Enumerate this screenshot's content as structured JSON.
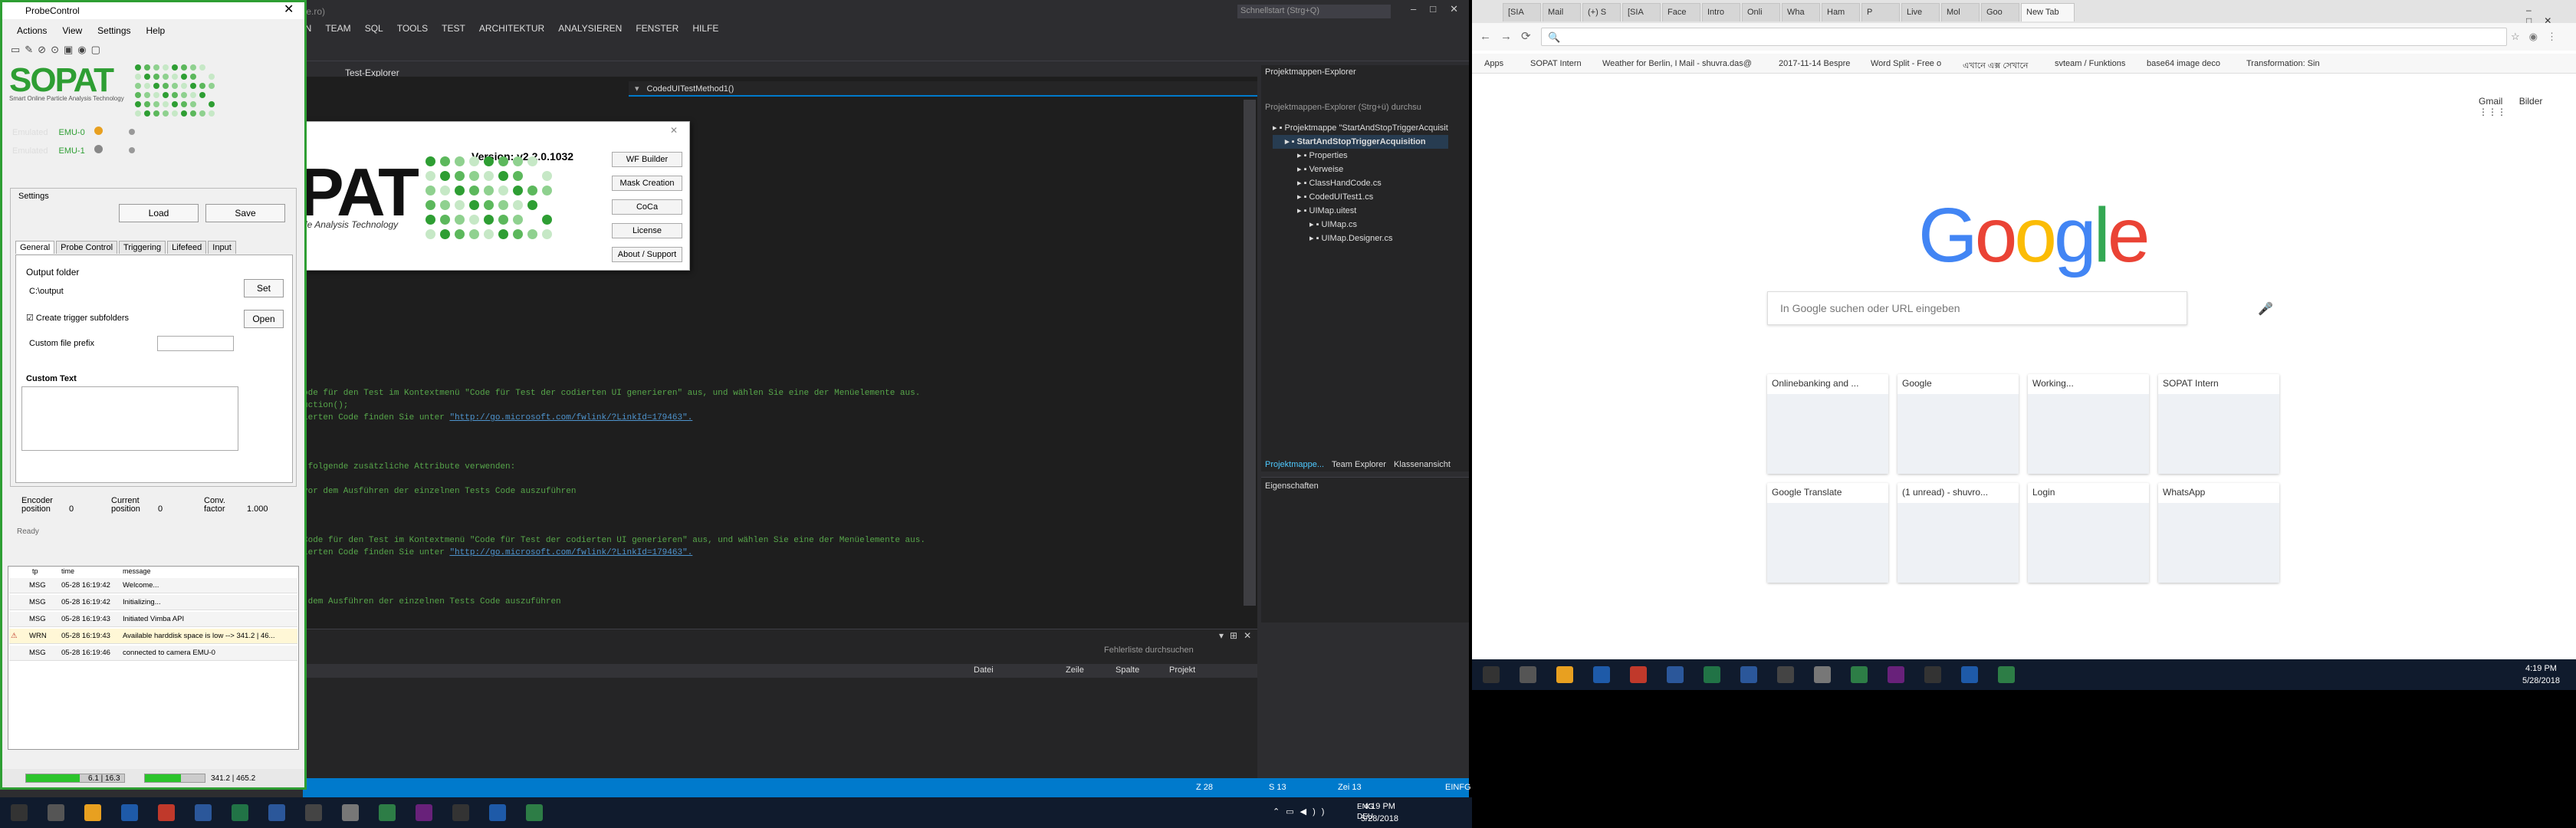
{
  "vs": {
    "title_fragment": "ine.ro)",
    "quick_launch": "Schnellstart (Strg+Q)",
    "menu": [
      "IGN",
      "TEAM",
      "SQL",
      "TOOLS",
      "TEST",
      "ARCHITEKTUR",
      "ANALYSIEREN",
      "FENSTER",
      "HILFE"
    ],
    "tab_test_explorer": "Test-Explorer",
    "doc_tab": "CodedUITestMethod1()",
    "code_lines": [
      {
        "text": "ode für den Test im Kontextmenü \"Code für Test der codierten UI generieren\" aus, und wählen Sie eine der Menüelemente aus.",
        "link": ""
      },
      {
        "text": "uction();",
        "link": ""
      },
      {
        "text": "ierten Code finden Sie unter ",
        "link": "\"http://go.microsoft.com/fwlink/?LinkId=179463\"."
      },
      {
        "text": "",
        "link": ""
      },
      {
        "text": "",
        "link": ""
      },
      {
        "text": "",
        "link": ""
      },
      {
        "text": " folgende zusätzliche Attribute verwenden:",
        "link": ""
      },
      {
        "text": "",
        "link": ""
      },
      {
        "text": "vor dem Ausführen der einzelnen Tests Code auszuführen",
        "link": ""
      },
      {
        "text": "",
        "link": ""
      },
      {
        "text": "",
        "link": ""
      },
      {
        "text": "",
        "link": ""
      },
      {
        "text": "Code für den Test im Kontextmenü \"Code für Test der codierten UI generieren\" aus, und wählen Sie eine der Menüelemente aus.",
        "link": ""
      },
      {
        "text": "ierten Code finden Sie unter ",
        "link": "\"http://go.microsoft.com/fwlink/?LinkId=179463\"."
      },
      {
        "text": "",
        "link": ""
      },
      {
        "text": "",
        "link": ""
      },
      {
        "text": "",
        "link": ""
      },
      {
        "text": " dem Ausführen der einzelnen Tests Code auszuführen",
        "link": ""
      }
    ],
    "errlist": {
      "search": "Fehlerliste durchsuchen",
      "cols": [
        "Datei",
        "Zeile",
        "Spalte",
        "Projekt"
      ]
    },
    "status": {
      "col": "Z 28",
      "sp": "S 13",
      "zei": "Zei 13",
      "mode": "EINFG"
    },
    "solution": {
      "header": "Projektmappen-Explorer",
      "search": "Projektmappen-Explorer (Strg+ü) durchsu",
      "items": [
        "Projektmappe \"StartAndStopTriggerAcquisit",
        "StartAndStopTriggerAcquisition",
        "Properties",
        "Verweise",
        "ClassHandCode.cs",
        "CodedUITest1.cs",
        "UIMap.uitest",
        "UIMap.cs",
        "UIMap.Designer.cs"
      ],
      "tabs": [
        "Projektmappe...",
        "Team Explorer",
        "Klassenansicht"
      ],
      "properties": "Eigenschaften"
    }
  },
  "chrome": {
    "tabs": [
      "[SIA",
      "Mail",
      "(+) S",
      "[SIA",
      "Face",
      "Intro",
      "Onli",
      "Wha",
      "Ham",
      "P",
      "Live",
      "Mol",
      "Goo",
      "New Tab"
    ],
    "bookmarks": [
      "Apps",
      "SOPAT Intern",
      "Weather for Berlin, I",
      "Mail - shuvra.das@",
      "2017-11-14 Bespre",
      "Word Split - Free o",
      "এখানে এক্স সেখানে",
      "svteam / Funktions",
      "base64 image deco",
      "Transformation: Sin"
    ],
    "top_links": [
      "Gmail",
      "Bilder"
    ],
    "search_placeholder": "In Google suchen oder URL eingeben",
    "tiles": [
      "Onlinebanking and ...",
      "Google",
      "Working...",
      "SOPAT Intern",
      "Google Translate",
      "(1 unread) - shuvro...",
      "Login",
      "WhatsApp"
    ],
    "clock_time": "4:19 PM",
    "clock_date": "5/28/2018"
  },
  "taskbar_left": {
    "lang": "ENG",
    "locale": "DEU",
    "time": "4:19 PM",
    "date": "5/28/2018"
  },
  "probe": {
    "title": "ProbeControl",
    "menu": [
      "Actions",
      "View",
      "Settings",
      "Help"
    ],
    "logo": "SOPAT",
    "logo_tagline": "Smart Online Particle Analysis Technology",
    "emulated": [
      {
        "label": "Emulated",
        "name": "EMU-0",
        "color": "#e8a020"
      },
      {
        "label": "Emulated",
        "name": "EMU-1",
        "color": "#888888"
      }
    ],
    "settings_label": "Settings",
    "load_label": "Load",
    "save_label": "Save",
    "tabs": [
      "General",
      "Probe Control",
      "Triggering",
      "Lifefeed",
      "Input"
    ],
    "output_folder_label": "Output folder",
    "output_folder_value": "C:\\output",
    "set_label": "Set",
    "create_subfolders_label": "Create trigger subfolders",
    "open_label": "Open",
    "custom_prefix_label": "Custom file prefix",
    "custom_text_label": "Custom Text",
    "encoder_pos_label": "Encoder position",
    "encoder_pos_value": "0",
    "current_pos_label": "Current position",
    "current_pos_value": "0",
    "conv_factor_label": "Conv. factor",
    "conv_factor_value": "1.000",
    "ready": "Ready",
    "log_cols": [
      "tp",
      "time",
      "message"
    ],
    "log": [
      {
        "tp": "MSG",
        "time": "05-28 16:19:42",
        "message": "Welcome..."
      },
      {
        "tp": "MSG",
        "time": "05-28 16:19:42",
        "message": "Initializing..."
      },
      {
        "tp": "MSG",
        "time": "05-28 16:19:43",
        "message": "Initiated Vimba API"
      },
      {
        "tp": "WRN",
        "time": "05-28 16:19:43",
        "message": "Available harddisk space is low --> 341.2 | 46..."
      },
      {
        "tp": "MSG",
        "time": "05-28 16:19:46",
        "message": "connected to camera EMU-0"
      }
    ],
    "status_fps": "6.1 | 16.3",
    "status_disk": "341.2 | 465.2",
    "bar1_fill": 0.55,
    "bar2_fill": 0.6
  },
  "about": {
    "pat": "PAT",
    "tagline": "cle Analysis Technology",
    "version": "Version: v2.2.0.1032",
    "buttons": [
      "WF Builder",
      "Mask Creation",
      "CoCa",
      "License",
      "About / Support"
    ]
  }
}
